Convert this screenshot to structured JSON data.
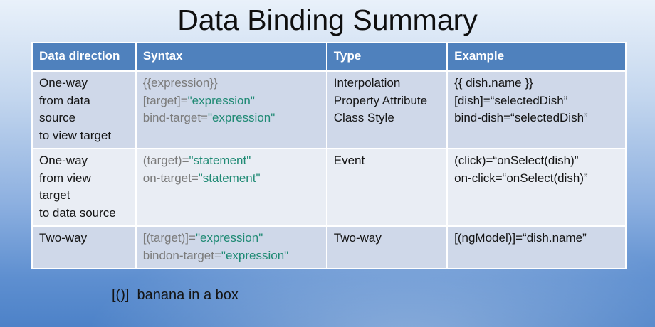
{
  "title": "Data Binding Summary",
  "table": {
    "headers": [
      "Data direction",
      "Syntax",
      "Type",
      "Example"
    ],
    "rows": [
      {
        "direction": [
          "One-way",
          "from data",
          "source",
          "to view target"
        ],
        "syntax": [
          {
            "pre": "{{expression}}",
            "str": "",
            "post": ""
          },
          {
            "pre": "[target]=",
            "str": "\"expression\"",
            "post": ""
          },
          {
            "pre": "bind-target=",
            "str": "\"expression\"",
            "post": ""
          }
        ],
        "type": [
          "Interpolation",
          "Property Attribute",
          "Class Style"
        ],
        "example": [
          "{{ dish.name }}",
          "[dish]=“selectedDish”",
          "bind-dish=“selectedDish”"
        ]
      },
      {
        "direction": [
          "One-way",
          "from view",
          "target",
          "to data source"
        ],
        "syntax": [
          {
            "pre": "(target)=",
            "str": "\"statement\"",
            "post": ""
          },
          {
            "pre": "on-target=",
            "str": "\"statement\"",
            "post": ""
          }
        ],
        "type": [
          "Event"
        ],
        "example": [
          "(click)=“onSelect(dish)”",
          "on-click=“onSelect(dish)”"
        ]
      },
      {
        "direction": [
          "Two-way"
        ],
        "syntax": [
          {
            "pre": "[(target)]=",
            "str": "\"expression\"",
            "post": ""
          },
          {
            "pre": "bindon-target=",
            "str": "\"expression\"",
            "post": ""
          }
        ],
        "type": [
          "Two-way"
        ],
        "example": [
          "[(ngModel)]=“dish.name”"
        ]
      }
    ]
  },
  "footnote": "[()]  banana in a box"
}
